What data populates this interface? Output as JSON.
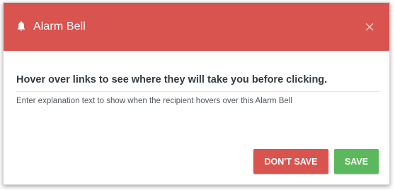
{
  "dialog": {
    "title": "Alarm Bell",
    "icon": "bell-icon",
    "close_label": "×",
    "headline": "Hover over links to see where they will take you before clicking.",
    "explanation": "Enter explanation text to show when the recipient hovers over this Alarm Bell",
    "buttons": {
      "dont_save": "DON'T SAVE",
      "save": "SAVE"
    }
  },
  "colors": {
    "header": "#d9534f",
    "danger": "#d9534f",
    "success": "#5cb85c"
  }
}
